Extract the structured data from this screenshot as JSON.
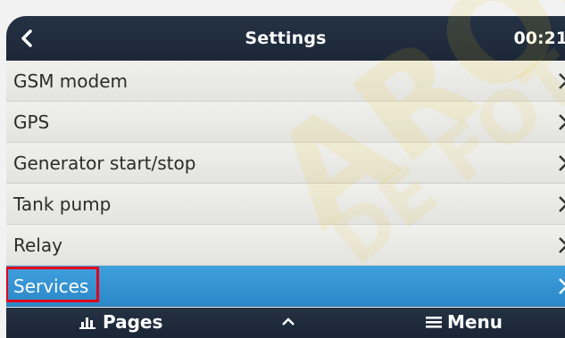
{
  "header": {
    "title": "Settings",
    "clock": "00:21"
  },
  "menu": {
    "items": [
      {
        "label": "GSM modem"
      },
      {
        "label": "GPS"
      },
      {
        "label": "Generator start/stop"
      },
      {
        "label": "Tank pump"
      },
      {
        "label": "Relay"
      },
      {
        "label": "Services",
        "selected": true
      }
    ]
  },
  "footer": {
    "pages_label": "Pages",
    "menu_label": "Menu"
  },
  "watermark": {
    "text_main": "ARONS",
    "text_sub": "DE FOTO"
  },
  "colors": {
    "bar": "#1c2838",
    "selected": "#2c88c8",
    "highlight": "#e3001b",
    "row": "#e9e9e6"
  },
  "icons": {
    "back": "chevron-left-icon",
    "row_arrow": "chevron-right-icon",
    "pages": "bar-chart-icon",
    "up": "chevron-up-icon",
    "menu": "hamburger-menu-icon"
  }
}
